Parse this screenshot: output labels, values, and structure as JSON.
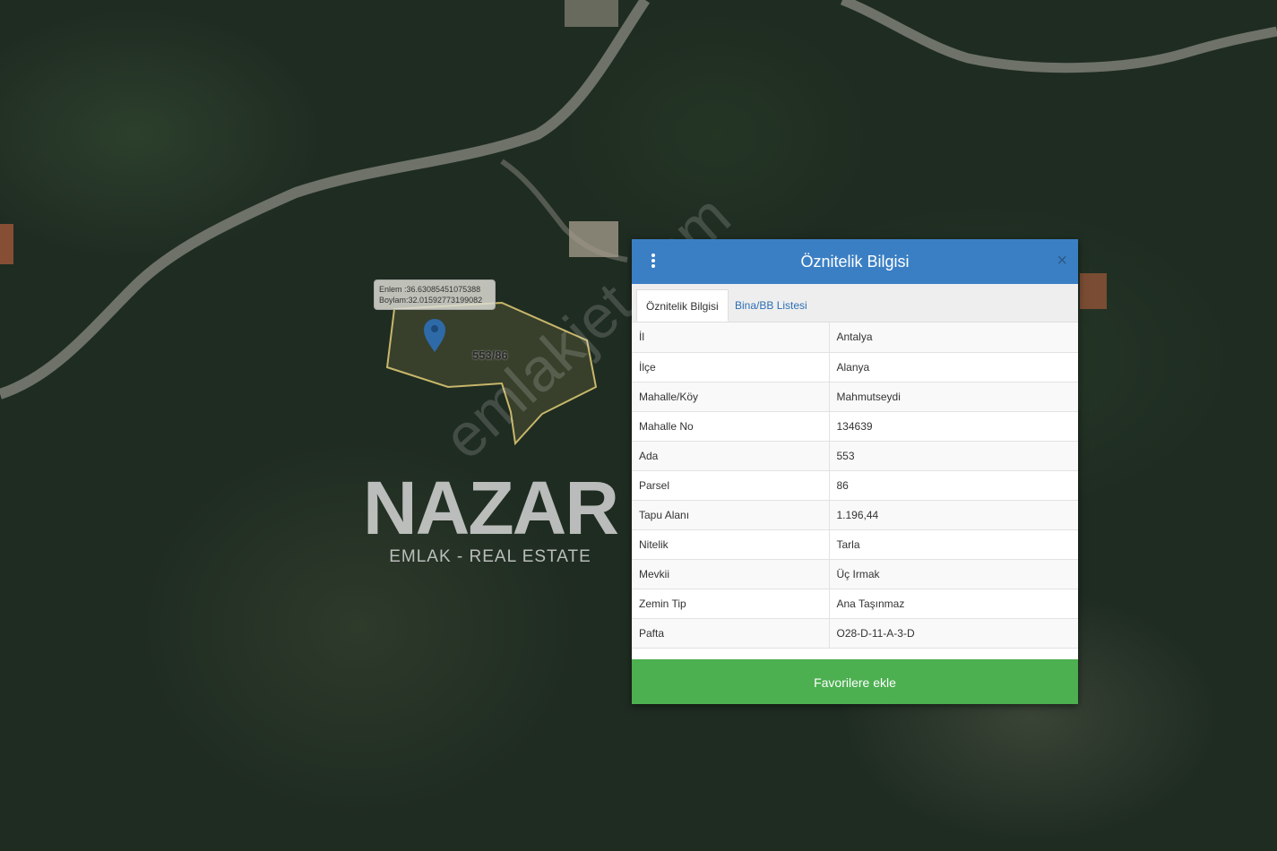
{
  "map": {
    "coord_tip": {
      "lat": "Enlem :36.63085451075388",
      "lon": "Boylam:32.01592773199082"
    },
    "parcel_label": "553/86",
    "watermark_brand": "NAZAR",
    "watermark_sub": "EMLAK - REAL ESTATE",
    "site_watermark": "emlakjet.com"
  },
  "panel": {
    "title": "Öznitelik Bilgisi",
    "tabs": [
      {
        "label": "Öznitelik Bilgisi",
        "active": true
      },
      {
        "label": "Bina/BB Listesi",
        "active": false
      }
    ],
    "rows": [
      {
        "key": "İl",
        "value": "Antalya"
      },
      {
        "key": "İlçe",
        "value": "Alanya"
      },
      {
        "key": "Mahalle/Köy",
        "value": "Mahmutseydi"
      },
      {
        "key": "Mahalle No",
        "value": "134639"
      },
      {
        "key": "Ada",
        "value": "553"
      },
      {
        "key": "Parsel",
        "value": "86"
      },
      {
        "key": "Tapu Alanı",
        "value": "1.196,44"
      },
      {
        "key": "Nitelik",
        "value": "Tarla"
      },
      {
        "key": "Mevkii",
        "value": "Üç Irmak"
      },
      {
        "key": "Zemin Tip",
        "value": "Ana Taşınmaz"
      },
      {
        "key": "Pafta",
        "value": "O28-D-11-A-3-D"
      }
    ],
    "favorite_button": "Favorilere ekle",
    "close_symbol": "×"
  },
  "colors": {
    "header": "#3a7fc4",
    "favorite": "#4caf50",
    "link": "#2d6fb5",
    "parcel_outline": "#c8b76a",
    "marker": "#2e6aa8"
  },
  "icons": {
    "menu": "kebab-menu-icon",
    "close": "close-icon",
    "marker": "map-pin-icon"
  }
}
